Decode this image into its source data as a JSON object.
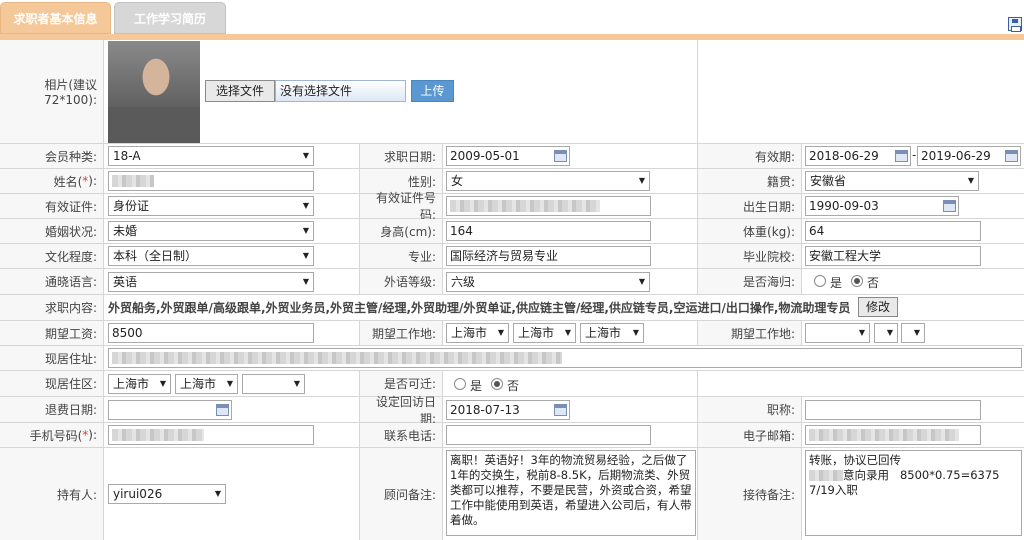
{
  "tabs": {
    "active": "求职者基本信息",
    "inactive": "工作学习简历"
  },
  "photo": {
    "label": "相片(建议72*100):",
    "choose_btn": "选择文件",
    "file_status": "没有选择文件",
    "upload_btn": "上传"
  },
  "member_type": {
    "label": "会员种类:",
    "value": "18-A"
  },
  "apply_date": {
    "label": "求职日期:",
    "value": "2009-05-01"
  },
  "validity": {
    "label": "有效期:",
    "start": "2018-06-29",
    "sep": "-",
    "end": "2019-06-29"
  },
  "name": {
    "label_pre": "姓名(",
    "star": "*",
    "label_post": "):"
  },
  "gender": {
    "label": "性别:",
    "value": "女"
  },
  "native_place": {
    "label": "籍贯:",
    "value": "安徽省"
  },
  "id_type": {
    "label": "有效证件:",
    "value": "身份证"
  },
  "id_number": {
    "label": "有效证件号码:"
  },
  "birth_date": {
    "label": "出生日期:",
    "value": "1990-09-03"
  },
  "marital": {
    "label": "婚姻状况:",
    "value": "未婚"
  },
  "height": {
    "label": "身高(cm):",
    "value": "164"
  },
  "weight": {
    "label": "体重(kg):",
    "value": "64"
  },
  "education": {
    "label": "文化程度:",
    "value": "本科（全日制）"
  },
  "major": {
    "label": "专业:",
    "value": "国际经济与贸易专业"
  },
  "school": {
    "label": "毕业院校:",
    "value": "安徽工程大学"
  },
  "language": {
    "label": "通晓语言:",
    "value": "英语"
  },
  "language_level": {
    "label": "外语等级:",
    "value": "六级"
  },
  "returnee": {
    "label": "是否海归:",
    "yes": "是",
    "no": "否"
  },
  "job_intent": {
    "label": "求职内容:",
    "value": "外贸船务,外贸跟单/高级跟单,外贸业务员,外贸主管/经理,外贸助理/外贸单证,供应链主管/经理,供应链专员,空运进口/出口操作,物流助理专员",
    "modify_btn": "修改"
  },
  "salary": {
    "label": "期望工资:",
    "value": "8500"
  },
  "work_place1": {
    "label": "期望工作地:",
    "v1": "上海市",
    "v2": "上海市",
    "v3": "上海市"
  },
  "work_place2": {
    "label": "期望工作地:"
  },
  "address": {
    "label": "现居住址:"
  },
  "district": {
    "label": "现居住区:",
    "v1": "上海市",
    "v2": "上海市"
  },
  "relocate": {
    "label": "是否可迁:",
    "yes": "是",
    "no": "否"
  },
  "refund_date": {
    "label": "退费日期:"
  },
  "visit_date": {
    "label": "设定回访日期:",
    "value": "2018-07-13"
  },
  "title": {
    "label": "职称:"
  },
  "mobile": {
    "label_pre": "手机号码(",
    "star": "*",
    "label_post": "):"
  },
  "phone": {
    "label": "联系电话:"
  },
  "email": {
    "label": "电子邮箱:"
  },
  "holder": {
    "label": "持有人:",
    "value": "yirui026"
  },
  "consultant_note": {
    "label": "顾问备注:",
    "value": "离职！英语好！3年的物流贸易经验，之后做了1年的交换生，税前8-8.5K，后期物流类、外贸类都可以推荐，不要是民营，外资或合资，希望工作中能使用到英语，希望进入公司后，有人带着做。"
  },
  "reception_note": {
    "label": "接待备注:",
    "line1": "转账，协议已回传",
    "line2_suffix": "意向录用",
    "line2_calc": "8500*0.75=6375",
    "line3": "7/19入职"
  }
}
